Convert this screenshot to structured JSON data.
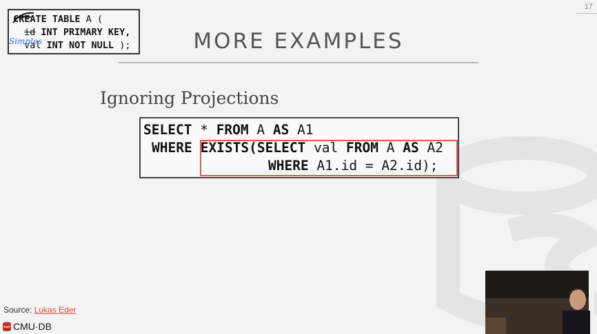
{
  "page_number": "17",
  "schema_box": {
    "line1_kw": "CREATE TABLE",
    "line1_rest": " A (",
    "line2_col": "id",
    "line2_kw": " INT PRIMARY KEY,",
    "line3_col": "val",
    "line3_kw": " INT NOT NULL",
    "line3_rest": " );",
    "annotation": "Simples"
  },
  "title": "MORE EXAMPLES",
  "subtitle": "Ignoring Projections",
  "code": {
    "l1_kw1": "SELECT",
    "l1_t1": " * ",
    "l1_kw2": "FROM",
    "l1_t2": " A ",
    "l1_kw3": "AS",
    "l1_t3": " A1",
    "l2_kw1": "WHERE",
    "l2_kw2": "EXISTS(SELECT",
    "l2_t1": " val ",
    "l2_kw3": "FROM",
    "l2_t2": " A ",
    "l2_kw4": "AS",
    "l2_t3": " A2",
    "l3_kw1": "WHERE",
    "l3_t1": " A1.id = A2.id);"
  },
  "source": {
    "label": "Source: ",
    "link": "Lukas Eder"
  },
  "brand": "CMU·DB",
  "colors": {
    "highlight": "#e55a4c",
    "link": "#d4523f"
  }
}
